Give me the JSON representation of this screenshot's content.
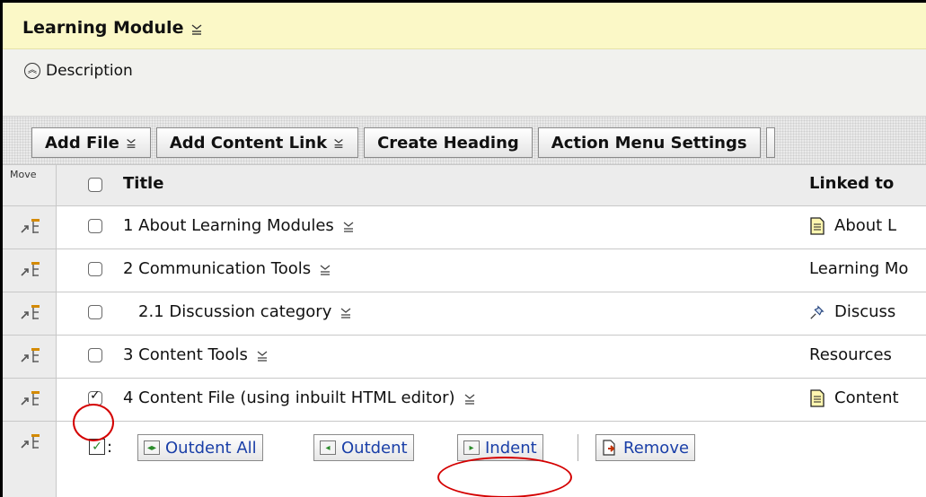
{
  "header": {
    "title": "Learning Module"
  },
  "description": {
    "label": "Description"
  },
  "toolbar": {
    "buttons": [
      {
        "label": "Add File",
        "has_menu": true
      },
      {
        "label": "Add Content Link",
        "has_menu": true
      },
      {
        "label": "Create Heading",
        "has_menu": false
      },
      {
        "label": "Action Menu Settings",
        "has_menu": false
      }
    ]
  },
  "table": {
    "move_label": "Move",
    "col_title": "Title",
    "col_linked": "Linked to",
    "rows": [
      {
        "title": "1 About Learning Modules",
        "linked": "About L",
        "linked_icon": "document-icon",
        "checked": false,
        "indent": false
      },
      {
        "title": "2 Communication Tools",
        "linked": "Learning Mo",
        "linked_icon": "",
        "checked": false,
        "indent": false
      },
      {
        "title": "2.1 Discussion category",
        "linked": "Discuss",
        "linked_icon": "pushpin-icon",
        "checked": false,
        "indent": true
      },
      {
        "title": "3 Content Tools",
        "linked": "Resources",
        "linked_icon": "",
        "checked": false,
        "indent": false
      },
      {
        "title": "4 Content File (using inbuilt HTML editor)",
        "linked": "Content",
        "linked_icon": "document-icon",
        "checked": true,
        "indent": false
      }
    ]
  },
  "actions": {
    "outdent_all": "Outdent All",
    "outdent": "Outdent",
    "indent": "Indent",
    "remove": "Remove"
  },
  "colors": {
    "header_bg": "#fbf8c7",
    "link_blue": "#1a3fa8",
    "highlight_red": "#d40000"
  }
}
